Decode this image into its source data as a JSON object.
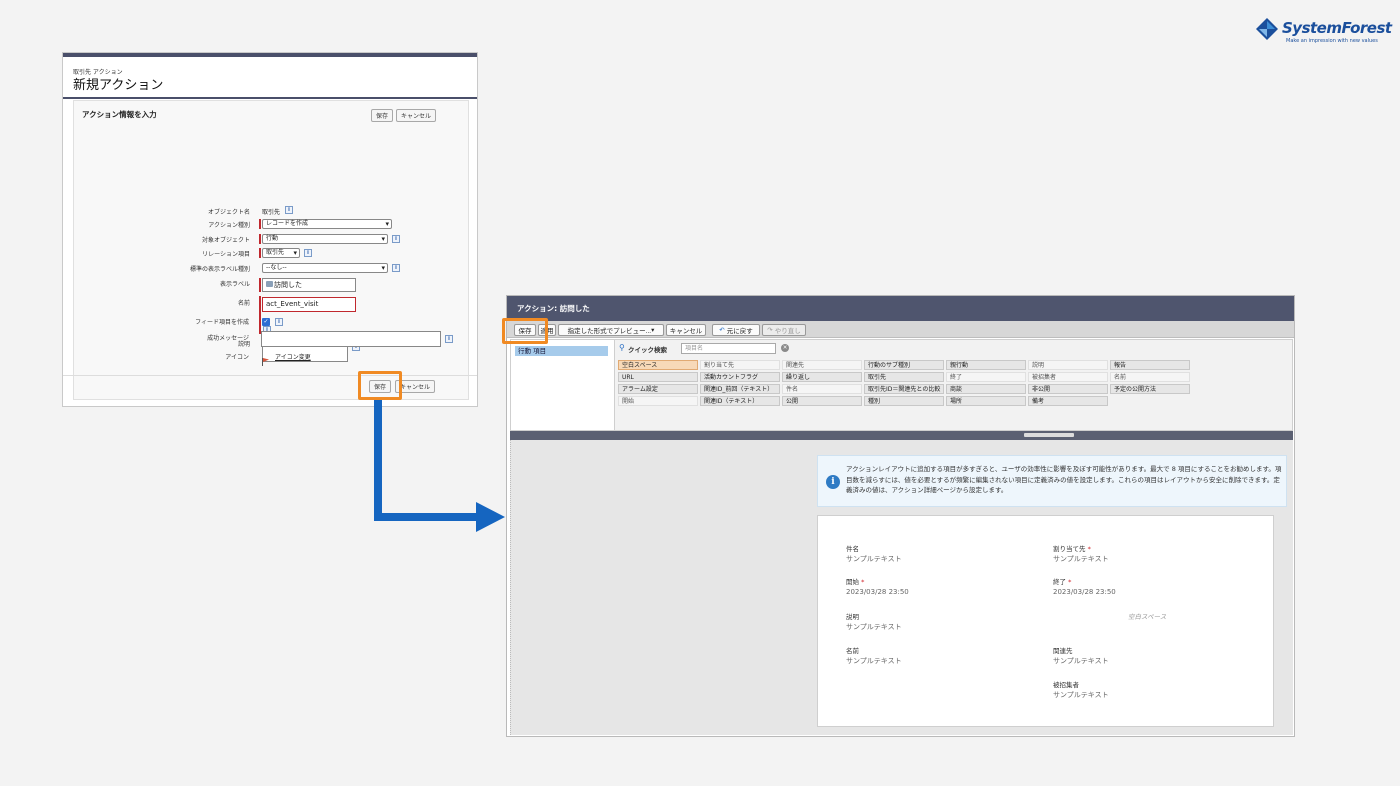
{
  "logo": {
    "name": "SystemForest",
    "tagline": "Make an impression with new values",
    "colors": {
      "primary": "#1b4f9c",
      "accent": "#3c8ed6"
    }
  },
  "left_form": {
    "breadcrumb": "取引先 アクション",
    "title": "新規アクション",
    "section_title": "アクション情報を入力",
    "save_label": "保存",
    "cancel_label": "キャンセル",
    "fields": {
      "object_name": {
        "label": "オブジェクト名",
        "value": "取引先"
      },
      "action_type": {
        "label": "アクション種別",
        "value": "レコードを作成"
      },
      "target_object": {
        "label": "対象オブジェクト",
        "value": "行動"
      },
      "relation_field": {
        "label": "リレーション項目",
        "value": "取引先"
      },
      "standard_label_type": {
        "label": "標準の表示ラベル種別",
        "value": "--なし--"
      },
      "display_label": {
        "label": "表示ラベル",
        "value": "訪問した"
      },
      "name": {
        "label": "名前",
        "value": "act_Event_visit"
      },
      "description": {
        "label": "説明",
        "value": ""
      },
      "feed_item": {
        "label": "フィード項目を作成"
      },
      "success_message": {
        "label": "成功メッセージ",
        "value": ""
      },
      "icon": {
        "label": "アイコン",
        "link": "アイコン変更"
      }
    },
    "info_glyph": "i",
    "info_icon": "info-icon"
  },
  "highlight_color": "#f08a23",
  "arrow_color": "#1565c0",
  "layout_editor": {
    "title": "アクション: 訪問した",
    "toolbar": {
      "save": "保存",
      "apply": "適用",
      "preview": "指定した形式でプレビュー...",
      "cancel": "キャンセル",
      "undo": "元に戻す",
      "redo": "やり直し"
    },
    "category": "行動 項目",
    "quick_search_label": "クイック検索",
    "quick_search_placeholder": "項目名",
    "palette": [
      [
        "空白スペース",
        "割り当て先",
        "関連先",
        "行動のサブ種別",
        "親行動",
        "説明",
        "報告"
      ],
      [
        "URL",
        "活動カウントフラグ",
        "繰り返し",
        "取引先",
        "終了",
        "被招集者",
        "名前"
      ],
      [
        "アラーム設定",
        "関連ID_前回（テキスト）",
        "件名",
        "取引先ID＝関連先との比較",
        "商談",
        "非公開",
        "予定の公開方法"
      ],
      [
        "開始",
        "関連ID（テキスト）",
        "公開",
        "種別",
        "場所",
        "備考"
      ]
    ],
    "palette_used": [
      "割り当て先",
      "関連先",
      "件名",
      "終了",
      "被招集者",
      "名前",
      "開始",
      "説明"
    ],
    "warning": "アクションレイアウトに追加する項目が多すぎると、ユーザの効率性に影響を及ぼす可能性があります。最大で 8 項目にすることをお勧めします。項目数を減らすには、値を必要とするが頻繁に編集されない項目に定義済みの値を設定します。これらの項目はレイアウトから安全に削除できます。定義済みの値は、アクション詳細ページから設定します。",
    "card": {
      "subject": {
        "label": "件名",
        "value": "サンプルテキスト"
      },
      "assigned": {
        "label": "割り当て先",
        "value": "サンプルテキスト"
      },
      "start": {
        "label": "開始",
        "value": "2023/03/28 23:50"
      },
      "end": {
        "label": "終了",
        "value": "2023/03/28 23:50"
      },
      "description": {
        "label": "説明",
        "value": "サンプルテキスト"
      },
      "blank_space": "空白スペース",
      "name": {
        "label": "名前",
        "value": "サンプルテキスト"
      },
      "related": {
        "label": "関連先",
        "value": "サンプルテキスト"
      },
      "invitees": {
        "label": "被招集者",
        "value": "サンプルテキスト"
      },
      "required_mark": "*"
    }
  }
}
